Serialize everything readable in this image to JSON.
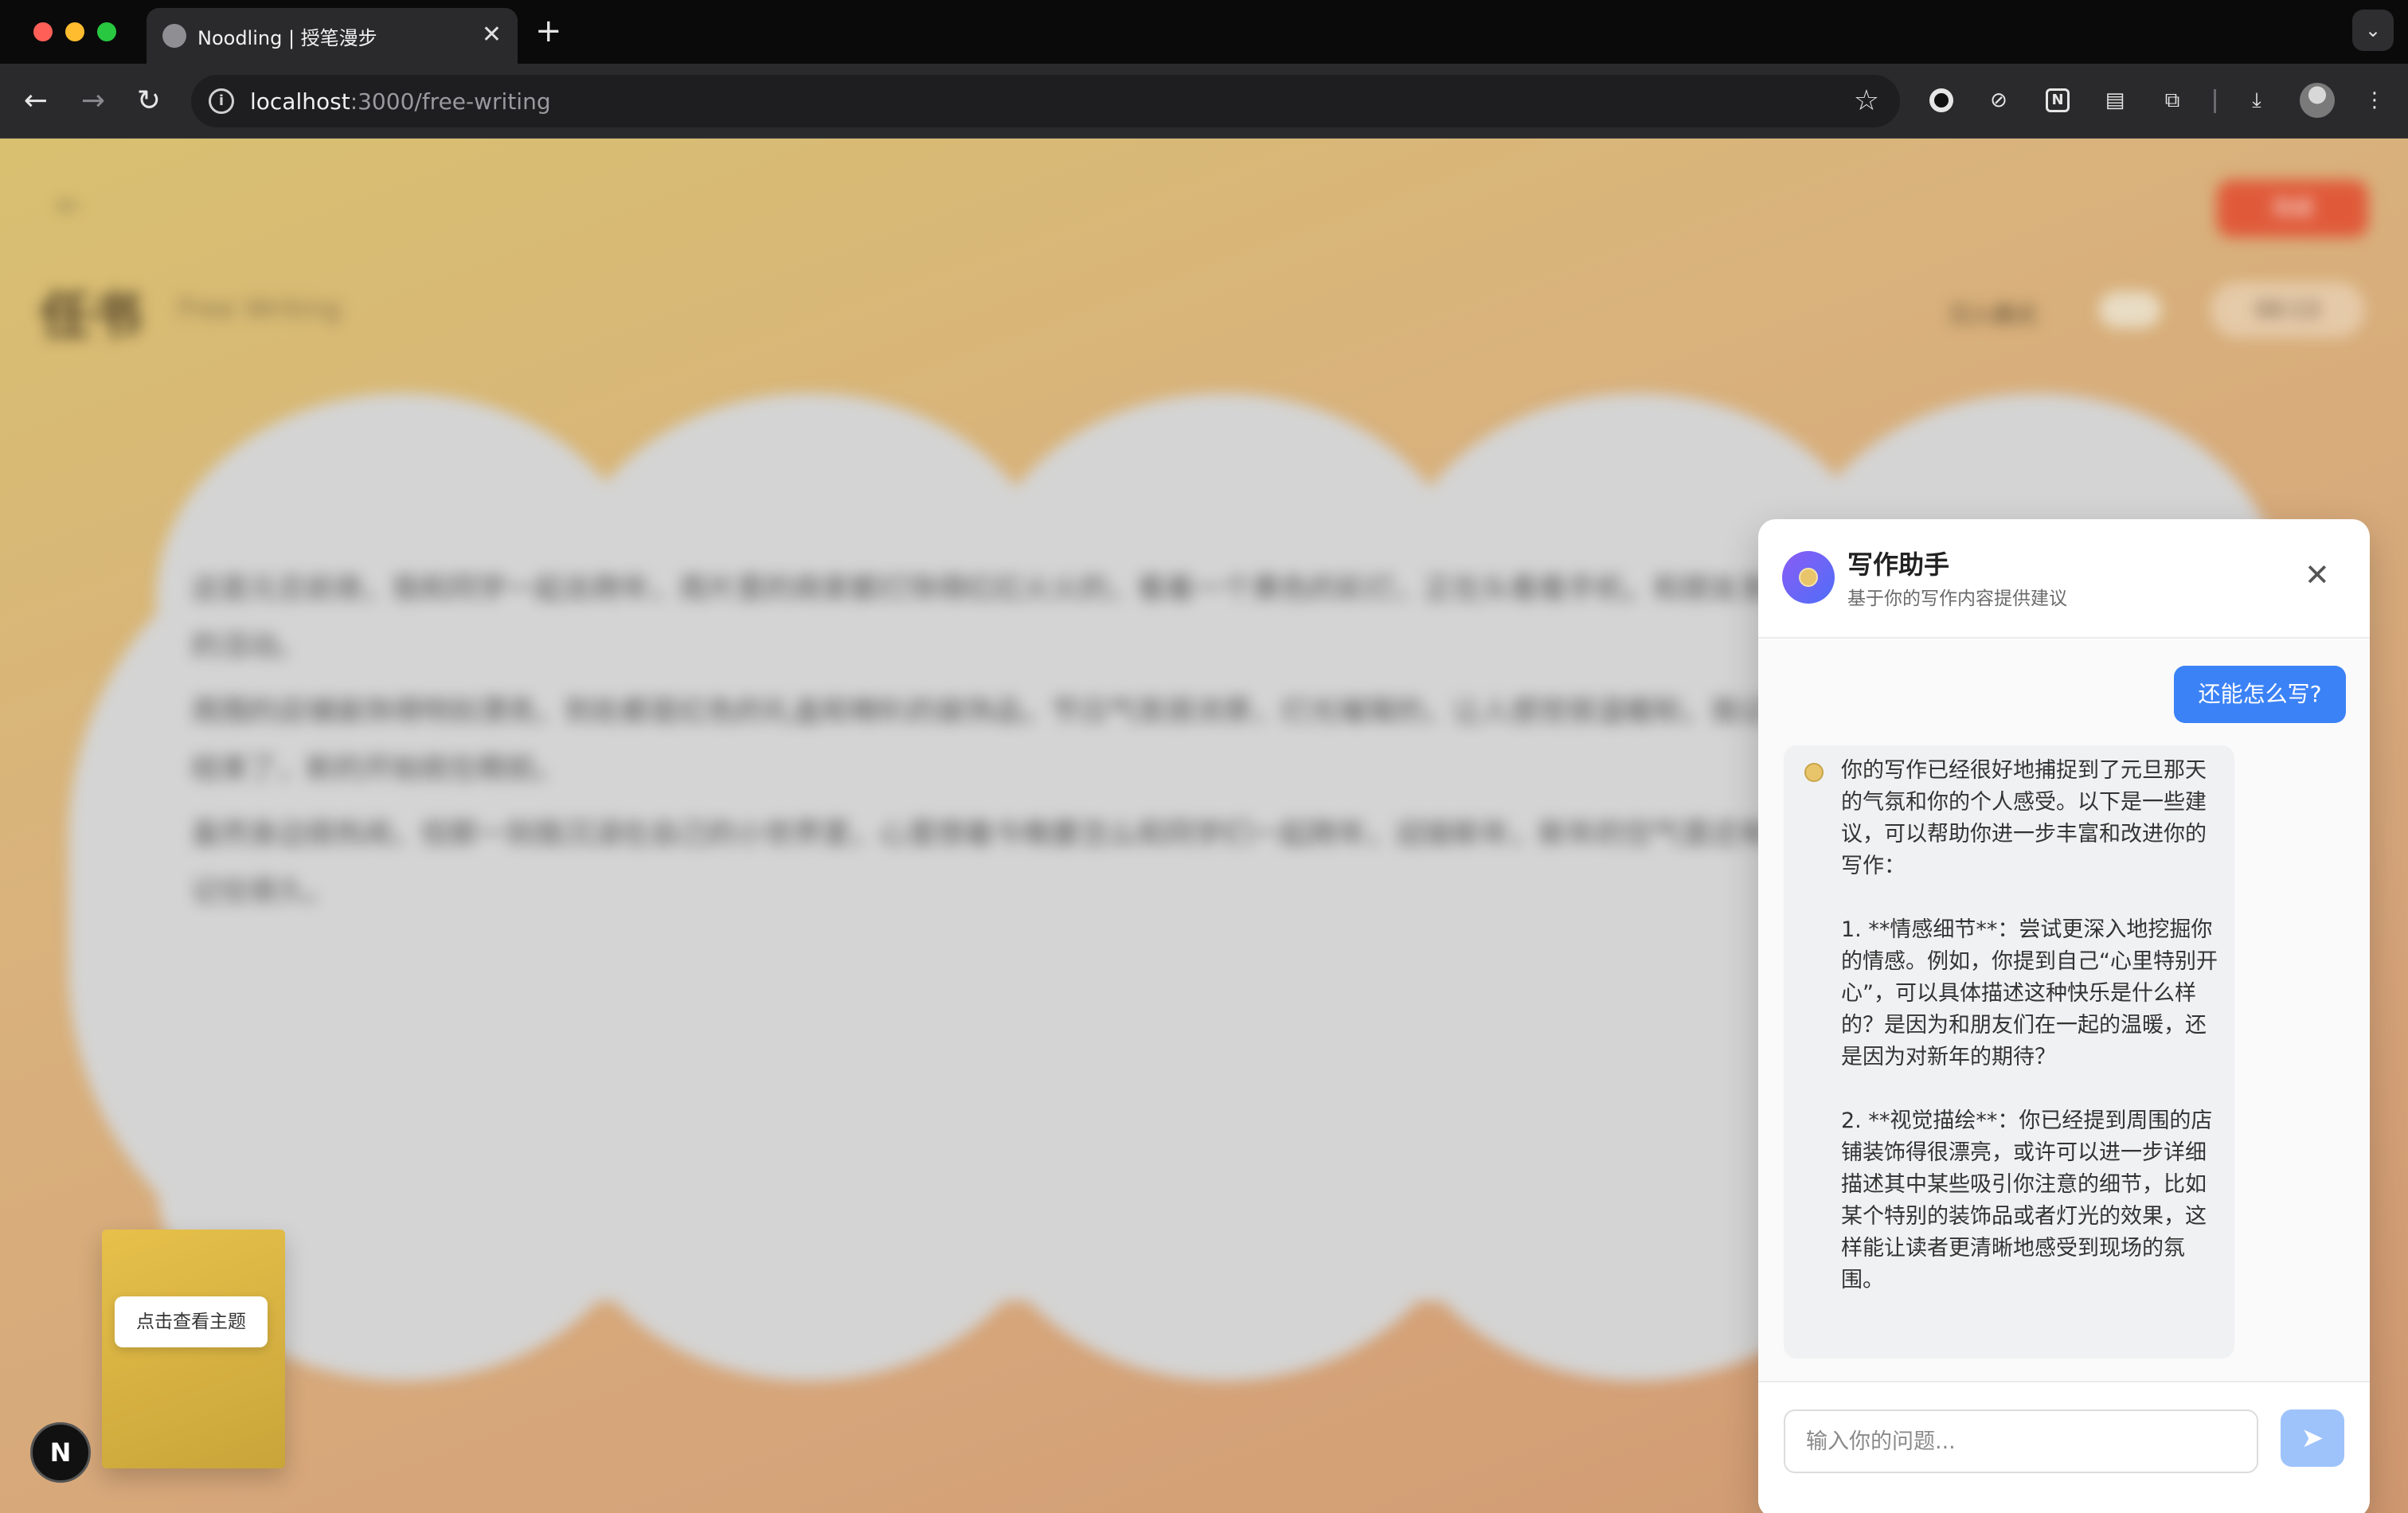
{
  "browser": {
    "tab_title": "Noodling | 授笔漫步",
    "tab_close": "✕",
    "new_tab": "+",
    "url_host": "localhost",
    "url_path": ":3000/free-writing"
  },
  "page": {
    "finish_label": "完成",
    "title": "任书",
    "subtitle": "Free Writing",
    "immersive_label": "沉入模式",
    "timer": "00:13",
    "editor_paragraphs": [
      "这是元旦前夜，我和同学一起去跨年，周片里的商家都灯饰得红红火火的，看着一个黄色的彩灯，正在头看看手机，和朋友发来的新年消息，也可能在看着那些有趣的活动。",
      "周围的店铺装饰得特别漂亮，到处都是红色的礼盒和喇叭的装饰品，节日气氛很浓厚，灯光璀璨的，让人感觉很温暖和，我记得当时心里特别开心，觉得这一年终于结束了，新的开始就在眼前。",
      "虽然身边很热闹，但那一刻我沉浸在自己的小世界里，心里想着今晚要怎么和同学们一起跨年，迎接新年，新年的空气里还有节日的热闹，让我觉得这一刻一定会被记住很久。"
    ],
    "topic_button": "点击查看主题",
    "next_badge": "N"
  },
  "chat": {
    "title": "写作助手",
    "subtitle": "基于你的写作内容提供建议",
    "close": "✕",
    "user_message": "还能怎么写?",
    "bot_message": "你的写作已经很好地捕捉到了元旦那天的气氛和你的个人感受。以下是一些建议，可以帮助你进一步丰富和改进你的写作：\n\n1. **情感细节**：尝试更深入地挖掘你的情感。例如，你提到自己“心里特别开心”，可以具体描述这种快乐是什么样的？是因为和朋友们在一起的温暖，还是因为对新年的期待？\n\n2. **视觉描绘**：你已经提到周围的店铺装饰得很漂亮，或许可以进一步详细描述其中某些吸引你注意的细节，比如某个特别的装饰品或者灯光的效果，这样能让读者更清晰地感受到现场的氛围。",
    "input_placeholder": "输入你的问题...",
    "send_icon": "➤"
  },
  "icons": {
    "back": "back-arrow-icon",
    "forward": "forward-arrow-icon",
    "reload": "reload-icon",
    "star": "bookmark-star-icon",
    "send": "paper-plane-icon"
  },
  "colors": {
    "accent_blue": "#3b82f6",
    "finish_red": "#e05a3a",
    "page_gradient_start": "#d8c070",
    "page_gradient_end": "#d09870"
  }
}
